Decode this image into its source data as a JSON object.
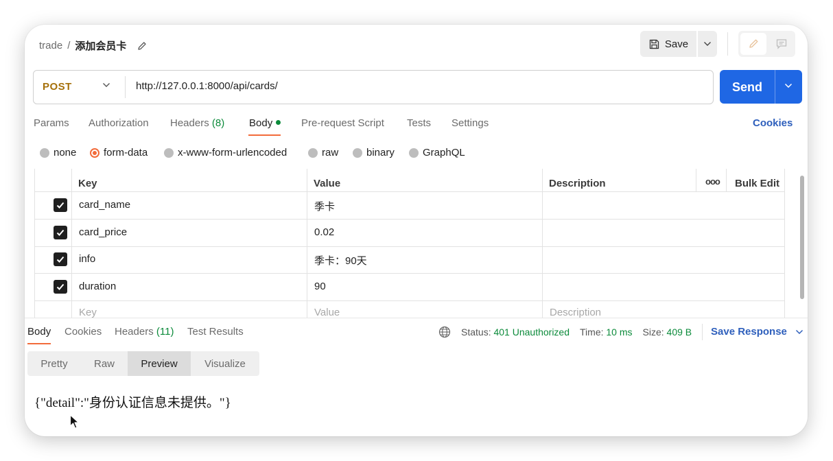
{
  "header": {
    "breadcrumb_parent": "trade",
    "breadcrumb_sep": "/",
    "breadcrumb_current": "添加会员卡",
    "save_label": "Save"
  },
  "request": {
    "method": "POST",
    "url": "http://127.0.0.1:8000/api/cards/",
    "send_label": "Send"
  },
  "tabs": [
    {
      "label": "Params"
    },
    {
      "label": "Authorization"
    },
    {
      "label": "Headers",
      "count": "(8)"
    },
    {
      "label": "Body"
    },
    {
      "label": "Pre-request Script"
    },
    {
      "label": "Tests"
    },
    {
      "label": "Settings"
    }
  ],
  "cookies_label": "Cookies",
  "body_types": [
    {
      "label": "none",
      "selected": false
    },
    {
      "label": "form-data",
      "selected": true
    },
    {
      "label": "x-www-form-urlencoded",
      "selected": false
    },
    {
      "label": "raw",
      "selected": false
    },
    {
      "label": "binary",
      "selected": false
    },
    {
      "label": "GraphQL",
      "selected": false
    }
  ],
  "table": {
    "headers": {
      "key": "Key",
      "value": "Value",
      "description": "Description",
      "more": "ooo",
      "bulk_edit": "Bulk Edit"
    },
    "rows": [
      {
        "key": "card_name",
        "value": "季卡",
        "checked": true
      },
      {
        "key": "card_price",
        "value": "0.02",
        "checked": true
      },
      {
        "key": "info",
        "value": "季卡：90天",
        "checked": true
      },
      {
        "key": "duration",
        "value": "90",
        "checked": true
      }
    ],
    "placeholder": {
      "key": "Key",
      "value": "Value",
      "description": "Description"
    }
  },
  "response": {
    "tabs": [
      {
        "label": "Body"
      },
      {
        "label": "Cookies"
      },
      {
        "label": "Headers",
        "count": "(11)"
      },
      {
        "label": "Test Results"
      }
    ],
    "status_label": "Status:",
    "status_value": "401 Unauthorized",
    "time_label": "Time:",
    "time_value": "10 ms",
    "size_label": "Size:",
    "size_value": "409 B",
    "save_response": "Save Response",
    "view_modes": [
      "Pretty",
      "Raw",
      "Preview",
      "Visualize"
    ],
    "active_view": "Preview",
    "preview_text": "{\"detail\":\"身份认证信息未提供。\"}"
  },
  "colors": {
    "accent": "#f26b3a",
    "send": "#1f67e4",
    "method": "#a5700a",
    "success": "#0b8a3a",
    "link": "#2e5fbc"
  }
}
